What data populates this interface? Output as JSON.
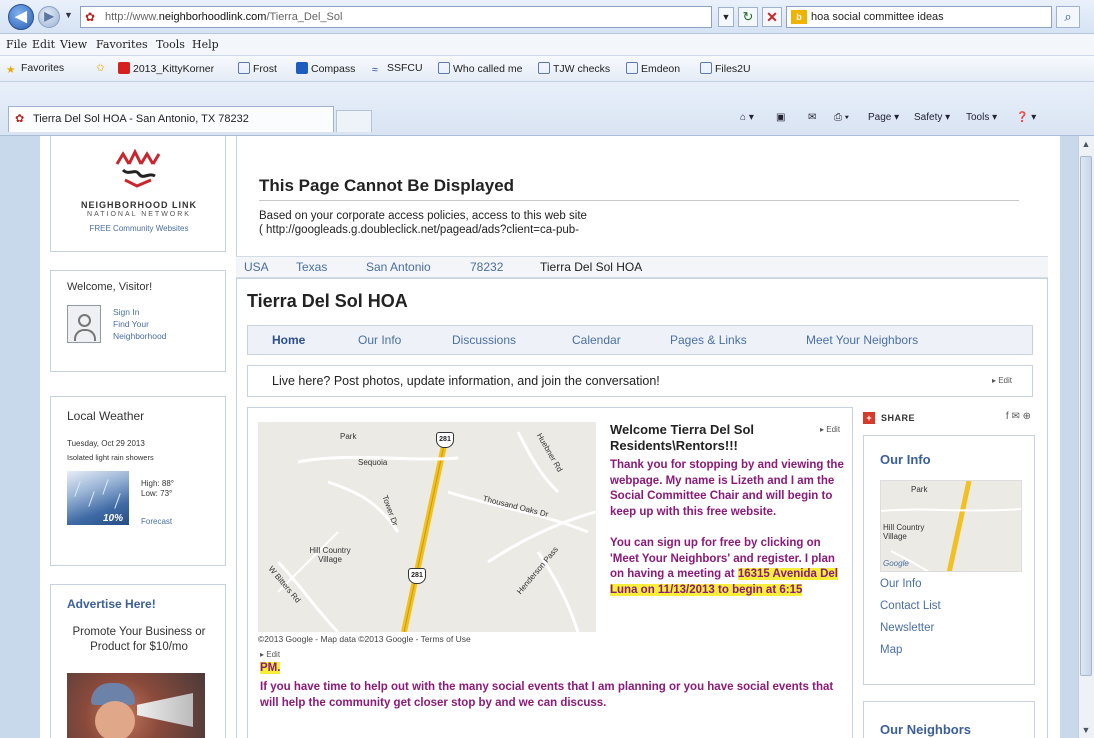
{
  "browser": {
    "url_prefix": "http://www.",
    "url_domain": "neighborhoodlink.com",
    "url_path": "/Tierra_Del_Sol",
    "search_query": "hoa social committee ideas",
    "search_provider_icon": "bing-icon",
    "menu": [
      "File",
      "Edit",
      "View",
      "Favorites",
      "Tools",
      "Help"
    ],
    "favorites_label": "Favorites",
    "favorites": [
      "2013_KittyKorner",
      "Frost",
      "Compass",
      "SSFCU",
      "Who called me",
      "TJW checks",
      "Emdeon",
      "Files2U"
    ],
    "tab_title": "Tierra Del Sol HOA - San Antonio, TX 78232",
    "commands": [
      "Page",
      "Safety",
      "Tools"
    ]
  },
  "logo": {
    "line1": "NEIGHBORHOOD LINK",
    "line2": "NATIONAL NETWORK",
    "line3": "FREE Community Websites",
    "colors": {
      "red": "#c8252c",
      "black": "#222222"
    }
  },
  "welcome": {
    "title": "Welcome, Visitor!",
    "links": [
      "Sign In",
      "Find Your",
      "Neighborhood"
    ]
  },
  "weather": {
    "title": "Local Weather",
    "date": "Tuesday, Oct 29 2013",
    "desc": "Isolated light rain showers",
    "high": "High: 88°",
    "low": "Low: 73°",
    "precip": "10%",
    "forecast": "Forecast"
  },
  "ad": {
    "title": "Advertise Here!",
    "text": "Promote Your Business or Product for $10/mo"
  },
  "banner": {
    "title": "This Page Cannot Be Displayed",
    "text1": "Based on your corporate access policies, access to this web site",
    "text2": "( http://googleads.g.doubleclick.net/pagead/ads?client=ca-pub-"
  },
  "breadcrumb": [
    "USA",
    "Texas",
    "San Antonio",
    "78232",
    "Tierra Del Sol HOA"
  ],
  "site": {
    "title": "Tierra Del Sol HOA",
    "tabs": [
      "Home",
      "Our Info",
      "Discussions",
      "Calendar",
      "Pages & Links",
      "Meet Your Neighbors"
    ],
    "live_text": "Live here? Post photos, update information, and join the conversation!",
    "edit": "Edit"
  },
  "map": {
    "labels": [
      "Park",
      "Sequoia",
      "Thousand Oaks Dr",
      "Hill Country Village",
      "Henderson Pass",
      "W Bitters Rd",
      "Tower Dr",
      "Huebner Rd"
    ],
    "shields": [
      "281",
      "281"
    ],
    "footer": "©2013 Google - Map data ©2013 Google - Terms of Use"
  },
  "message": {
    "heading": "Welcome Tierra Del Sol Residents\\Rentors!!!",
    "p1": "Thank you for stopping by and viewing the webpage. My name is Lizeth and I am the Social Committee Chair and will begin to keep up with this free website.",
    "p2_a": "You can sign up for free by clicking on 'Meet Your Neighbors' and register. I plan on having a meeting at ",
    "p2_b": "16315 Avenida Del Luna on 11/13/2013 to begin at 6:15",
    "pm": "PM.",
    "p3": "If you have time to help out with the many social events that I am planning or you have social events that will help the community get closer stop by and we can discuss.",
    "text_color": "#8b1a7a",
    "highlight_color": "#f6ee3a"
  },
  "right": {
    "share": "SHARE",
    "our_info_title": "Our Info",
    "mini_map_labels": [
      "Park",
      "Hill Country Village",
      "Google"
    ],
    "links": [
      "Our Info",
      "Contact List",
      "Newsletter",
      "Map"
    ],
    "neighbors_title": "Our Neighbors"
  }
}
